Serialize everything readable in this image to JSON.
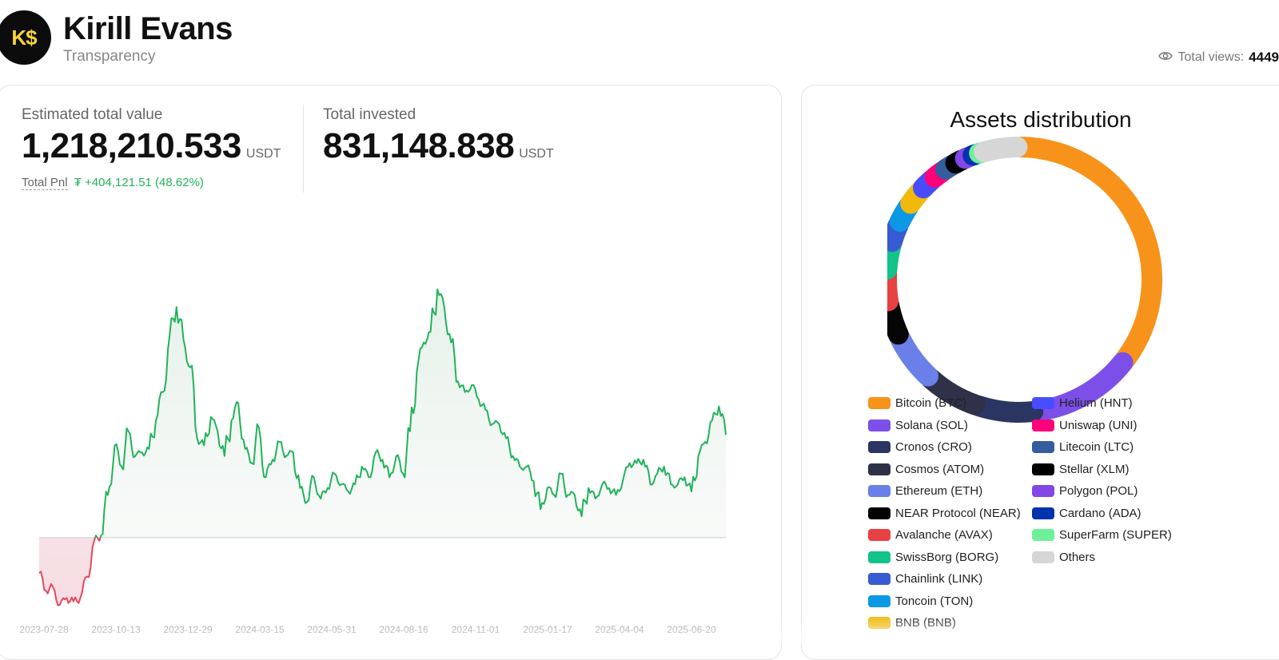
{
  "profile": {
    "avatar_text": "K$",
    "name": "Kirill Evans",
    "subtitle": "Transparency",
    "views_label": "Total views:",
    "views_value": "4449"
  },
  "stats": {
    "estimated_label": "Estimated total value",
    "estimated_value": "1,218,210.533",
    "estimated_unit": "USDT",
    "invested_label": "Total invested",
    "invested_value": "831,148.838",
    "invested_unit": "USDT",
    "pnl_label": "Total Pnl",
    "pnl_value": "₮ +404,121.51 (48.62%)"
  },
  "colors": {
    "positive": "#21b35a",
    "negative": "#e5475d",
    "zero_line": "#cfcfcf"
  },
  "chart_data": {
    "type": "line",
    "x_ticks": [
      "2023-07-28",
      "2023-10-13",
      "2023-12-29",
      "2024-03-15",
      "2024-05-31",
      "2024-08-16",
      "2024-11-01",
      "2025-01-17",
      "2025-04-04",
      "2025-06-20"
    ],
    "baseline_value": 0,
    "ylim": [
      -210000,
      840000
    ],
    "series": [
      {
        "values": [
          -100000,
          -150000,
          -140000,
          -190000,
          -170000,
          -180000,
          -170000,
          -110000,
          -10000,
          5000,
          120000,
          260000,
          200000,
          300000,
          230000,
          240000,
          250000,
          330000,
          410000,
          570000,
          650000,
          560000,
          480000,
          280000,
          260000,
          340000,
          300000,
          230000,
          330000,
          380000,
          250000,
          210000,
          310000,
          170000,
          220000,
          270000,
          230000,
          240000,
          140000,
          100000,
          170000,
          110000,
          140000,
          180000,
          150000,
          130000,
          150000,
          200000,
          170000,
          240000,
          220000,
          170000,
          230000,
          180000,
          300000,
          470000,
          550000,
          580000,
          700000,
          650000,
          550000,
          440000,
          410000,
          430000,
          390000,
          360000,
          320000,
          320000,
          280000,
          230000,
          200000,
          200000,
          160000,
          80000,
          140000,
          120000,
          180000,
          120000,
          120000,
          60000,
          140000,
          110000,
          150000,
          140000,
          120000,
          160000,
          210000,
          210000,
          220000,
          150000,
          180000,
          200000,
          150000,
          150000,
          170000,
          130000,
          230000,
          270000,
          330000,
          370000,
          290000
        ]
      }
    ]
  },
  "assets": {
    "title": "Assets distribution",
    "items": [
      {
        "label": "Bitcoin (BTC)",
        "color": "#f7931a",
        "pct": 35.5
      },
      {
        "label": "Solana (SOL)",
        "color": "#7c4fe8",
        "pct": 12.6
      },
      {
        "label": "Cronos (CRO)",
        "color": "#2b3562",
        "pct": 7.1
      },
      {
        "label": "Cosmos (ATOM)",
        "color": "#2e3147",
        "pct": 6.6
      },
      {
        "label": "Ethereum (ETH)",
        "color": "#6a80e8",
        "pct": 6.2
      },
      {
        "label": "NEAR Protocol (NEAR)",
        "color": "#050505",
        "pct": 4.2
      },
      {
        "label": "Avalanche (AVAX)",
        "color": "#e84142",
        "pct": 3.8
      },
      {
        "label": "SwissBorg (BORG)",
        "color": "#12c38a",
        "pct": 3.4
      },
      {
        "label": "Chainlink (LINK)",
        "color": "#375bd2",
        "pct": 2.6
      },
      {
        "label": "Toncoin (TON)",
        "color": "#0d98e5",
        "pct": 2.5
      },
      {
        "label": "BNB (BNB)",
        "color": "#f0b90b",
        "pct": 2.4
      },
      {
        "label": "Helium (HNT)",
        "color": "#474dff",
        "pct": 1.9
      },
      {
        "label": "Uniswap (UNI)",
        "color": "#ff007a",
        "pct": 1.6
      },
      {
        "label": "Litecoin (LTC)",
        "color": "#345d9d",
        "pct": 1.4
      },
      {
        "label": "Stellar (XLM)",
        "color": "#000000",
        "pct": 1.3
      },
      {
        "label": "Polygon (POL)",
        "color": "#8247e5",
        "pct": 1.0
      },
      {
        "label": "Cardano (ADA)",
        "color": "#0033ad",
        "pct": 0.8
      },
      {
        "label": "SuperFarm (SUPER)",
        "color": "#6ef09a",
        "pct": 0.6
      },
      {
        "label": "Others",
        "color": "#d6d6d6",
        "pct": 4.5
      }
    ]
  }
}
